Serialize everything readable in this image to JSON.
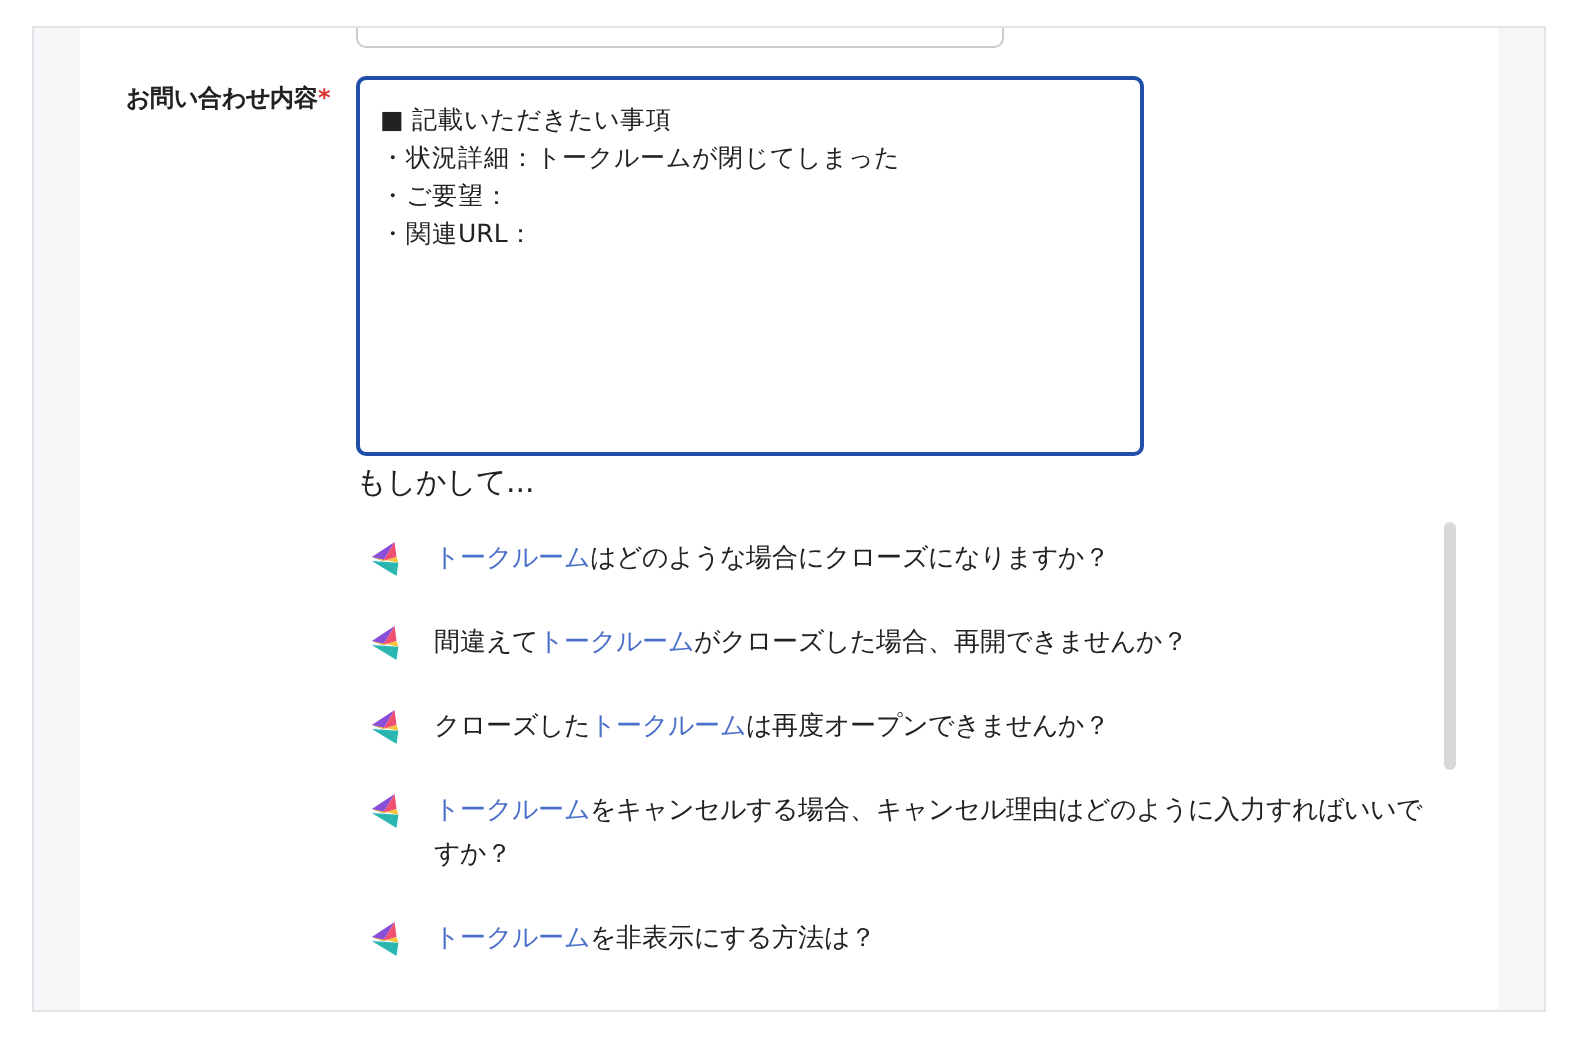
{
  "form": {
    "field": {
      "label": "お問い合わせ内容",
      "required_mark": "*",
      "lines": [
        "■ 記載いただきたい事項",
        "・状況詳細：トークルームが閉じてしまった",
        "・ご要望：",
        "・関連URL："
      ]
    }
  },
  "suggestions": {
    "heading": "もしかして...",
    "items": [
      {
        "parts": [
          {
            "text": "トークルーム",
            "link": true
          },
          {
            "text": "はどのような場合にクローズになりますか？",
            "link": false
          }
        ]
      },
      {
        "parts": [
          {
            "text": "間違えて",
            "link": false
          },
          {
            "text": "トークルーム",
            "link": true
          },
          {
            "text": "がクローズした場合、再開できませんか？",
            "link": false
          }
        ]
      },
      {
        "parts": [
          {
            "text": "クローズした",
            "link": false
          },
          {
            "text": "トークルーム",
            "link": true
          },
          {
            "text": "は再度オープンできませんか？",
            "link": false
          }
        ]
      },
      {
        "parts": [
          {
            "text": "トークルーム",
            "link": true
          },
          {
            "text": "をキャンセルする場合、キャンセル理由はどのように入力すればいいですか？",
            "link": false
          }
        ]
      },
      {
        "parts": [
          {
            "text": "トークルーム",
            "link": true
          },
          {
            "text": "を非表示にする方法は？",
            "link": false
          }
        ]
      }
    ]
  }
}
